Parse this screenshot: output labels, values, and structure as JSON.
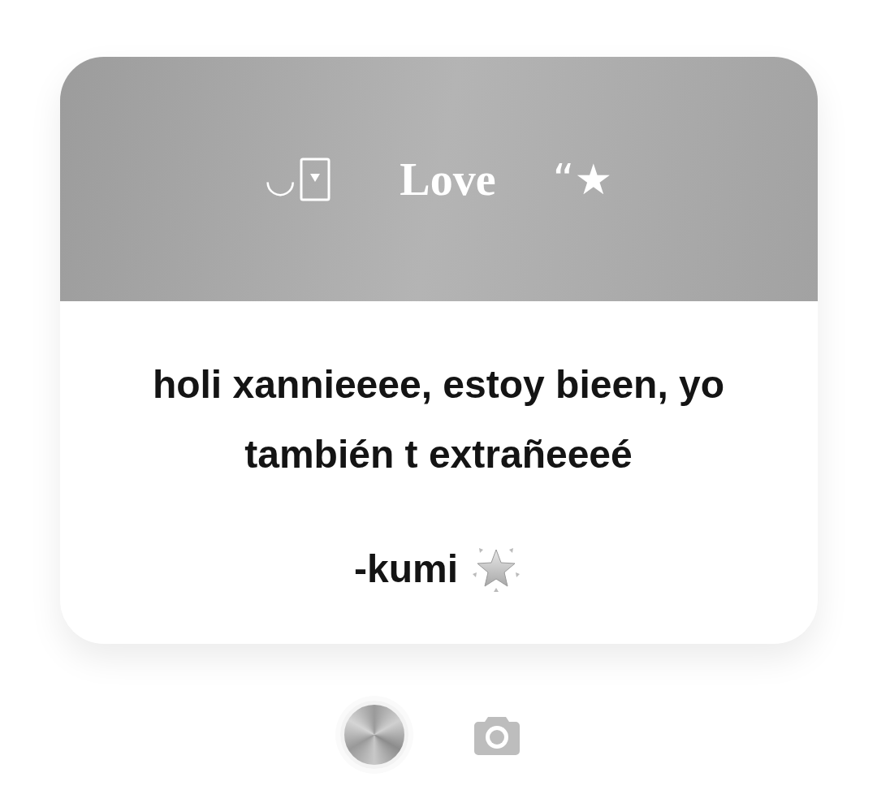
{
  "card": {
    "header": {
      "left_mark": "◡",
      "title": "Love",
      "right_mark": "“★"
    },
    "message": "holi xannieeee, estoy bieen, yo también t extrañeeeé",
    "signature": "-kumi"
  }
}
